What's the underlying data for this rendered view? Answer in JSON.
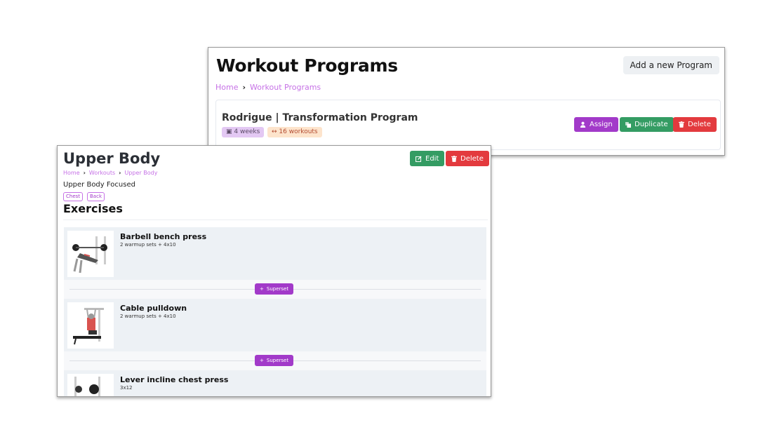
{
  "programs_page": {
    "title": "Workout Programs",
    "add_button": "Add a new Program",
    "breadcrumb": [
      "Home",
      "Workout Programs"
    ],
    "program": {
      "name": "Rodrigue | Transformation Program",
      "weeks": "4 weeks",
      "workouts": "16 workouts",
      "actions": {
        "assign": "Assign",
        "duplicate": "Duplicate",
        "delete": "Delete"
      }
    }
  },
  "workout_page": {
    "title": "Upper Body",
    "edit_button": "Edit",
    "delete_button": "Delete",
    "breadcrumb": [
      "Home",
      "Workouts",
      "Upper Body"
    ],
    "description": "Upper Body Focused",
    "tags": [
      "Chest",
      "Back"
    ],
    "exercises_heading": "Exercises",
    "exercises": [
      {
        "name": "Barbell bench press",
        "sets": "2 warmup sets + 4x10"
      },
      {
        "name": "Cable pulldown",
        "sets": "2 warmup sets + 4x10"
      },
      {
        "name": "Lever incline chest press",
        "sets": "3x12"
      }
    ],
    "superset_label": "Superset"
  },
  "colors": {
    "accent": "#a23ac9",
    "success": "#349c63",
    "danger": "#e33a3e",
    "link": "#c671e6"
  }
}
